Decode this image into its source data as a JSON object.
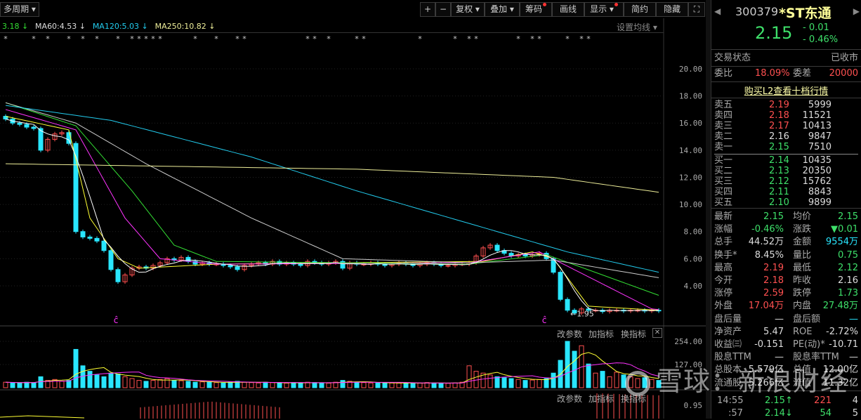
{
  "toolbar": {
    "period": "多周期 ▾",
    "plus": "+",
    "minus": "−",
    "fuquan": "复权",
    "diejia": "叠加",
    "chouma": "筹码",
    "huaxian": "画线",
    "xianshi": "显示",
    "jianyue": "简约",
    "yincang": "隐藏",
    "fullscreen": "⛶",
    "arrow": "▾"
  },
  "legend": {
    "ma30": "3.18 ↓",
    "ma60": "MA60:4.53 ↓",
    "ma120": "MA120:5.03 ↓",
    "ma250": "MA250:10.82 ↓",
    "settings": "设置均线 ▾"
  },
  "axis": {
    "price": [
      "20.00",
      "18.00",
      "16.00",
      "14.00",
      "12.00",
      "10.00",
      "8.00",
      "6.00",
      "4.00"
    ],
    "volume": [
      "254.00",
      "127.00"
    ],
    "third": [
      "0.95"
    ]
  },
  "annotations": {
    "low_label": "←1.95",
    "marker": "ĉ",
    "star": "*"
  },
  "sub_panel": {
    "change_params": "改参数",
    "add_indicator": "加指标",
    "switch_indicator": "换指标",
    "close": "✕"
  },
  "colors": {
    "up": "#ff5050",
    "down": "#29e6ff",
    "ma5": "#ffffff",
    "ma10": "#ffff33",
    "ma20": "#ff33ff",
    "ma30": "#33dd33",
    "ma60": "#cccccc",
    "ma120": "#22ccee",
    "ma250": "#eeee99"
  },
  "chart_data": {
    "type": "candlestick",
    "closes": [
      16.3,
      16.0,
      15.9,
      15.7,
      15.6,
      14.0,
      14.8,
      15.2,
      15.3,
      14.5,
      8.0,
      7.6,
      7.5,
      7.3,
      6.6,
      5.2,
      4.3,
      4.8,
      5.3,
      5.4,
      5.3,
      5.5,
      5.7,
      6.0,
      5.9,
      6.1,
      5.8,
      5.6,
      5.7,
      5.6,
      5.6,
      5.5,
      5.4,
      5.2,
      5.5,
      5.6,
      5.7,
      5.6,
      5.8,
      5.6,
      5.7,
      5.6,
      5.5,
      5.8,
      5.7,
      5.6,
      5.7,
      5.8,
      5.3,
      5.7,
      5.6,
      5.6,
      5.7,
      5.6,
      5.5,
      5.6,
      5.7,
      5.6,
      5.5,
      5.6,
      5.7,
      5.6,
      5.5,
      5.5,
      5.6,
      5.6,
      5.7,
      6.2,
      6.8,
      7.0,
      6.6,
      6.4,
      6.2,
      6.3,
      6.2,
      6.3,
      6.4,
      6.0,
      5.0,
      3.0,
      2.2,
      2.0,
      2.3,
      2.2,
      2.2,
      2.1,
      2.2,
      2.2,
      2.15,
      2.2,
      2.2,
      2.15,
      2.2,
      2.15
    ],
    "volumes": [
      30,
      28,
      25,
      30,
      26,
      60,
      40,
      45,
      35,
      40,
      210,
      120,
      90,
      70,
      60,
      80,
      75,
      60,
      50,
      40,
      35,
      40,
      45,
      50,
      40,
      38,
      35,
      30,
      32,
      30,
      28,
      26,
      30,
      35,
      30,
      28,
      26,
      30,
      28,
      26,
      25,
      28,
      26,
      30,
      28,
      26,
      25,
      30,
      40,
      35,
      30,
      28,
      26,
      25,
      28,
      26,
      25,
      24,
      26,
      25,
      28,
      26,
      25,
      24,
      26,
      30,
      120,
      90,
      80,
      70,
      60,
      55,
      50,
      45,
      40,
      42,
      45,
      50,
      80,
      150,
      254,
      200,
      230,
      130,
      80,
      90,
      60,
      85,
      70,
      60,
      50,
      55,
      45,
      40
    ],
    "ma_knots": {
      "ma10": [
        [
          0,
          16.5
        ],
        [
          9,
          15.5
        ],
        [
          12,
          9
        ],
        [
          16,
          6
        ],
        [
          19,
          5.3
        ],
        [
          30,
          5.6
        ],
        [
          68,
          5.8
        ],
        [
          75,
          6.5
        ],
        [
          78,
          6.0
        ],
        [
          83,
          2.5
        ],
        [
          93,
          2.2
        ]
      ],
      "ma20": [
        [
          0,
          17
        ],
        [
          10,
          15.5
        ],
        [
          17,
          9
        ],
        [
          22,
          6
        ],
        [
          30,
          5.6
        ],
        [
          66,
          5.7
        ],
        [
          76,
          6.5
        ],
        [
          92,
          2.3
        ],
        [
          93,
          2.25
        ]
      ],
      "ma30": [
        [
          0,
          17.5
        ],
        [
          10,
          15.8
        ],
        [
          18,
          11
        ],
        [
          24,
          7
        ],
        [
          30,
          5.8
        ],
        [
          66,
          5.6
        ],
        [
          77,
          6.3
        ],
        [
          93,
          3.3
        ]
      ],
      "ma60": [
        [
          0,
          17.5
        ],
        [
          10,
          16
        ],
        [
          20,
          13
        ],
        [
          35,
          9
        ],
        [
          48,
          6
        ],
        [
          66,
          5.7
        ],
        [
          78,
          5.9
        ],
        [
          93,
          4.6
        ]
      ],
      "ma120": [
        [
          0,
          17.3
        ],
        [
          15,
          16.2
        ],
        [
          35,
          13.5
        ],
        [
          50,
          11
        ],
        [
          70,
          8.0
        ],
        [
          80,
          6.5
        ],
        [
          93,
          5.0
        ]
      ],
      "ma250": [
        [
          0,
          13.0
        ],
        [
          50,
          12.6
        ],
        [
          78,
          12.0
        ],
        [
          93,
          10.9
        ]
      ]
    },
    "star_indices": [
      0,
      4,
      6,
      9,
      11,
      13,
      16,
      18,
      19,
      20,
      21,
      22,
      27,
      30,
      33,
      34,
      43,
      44,
      46,
      50,
      51,
      59,
      64,
      66,
      67,
      73,
      75,
      76,
      80,
      82,
      83
    ],
    "marker_indices": [
      16,
      77
    ],
    "ylim": [
      1.5,
      20.5
    ]
  },
  "quote": {
    "code": "300379",
    "name": "*ST东通",
    "price": "2.15",
    "change": "- 0.01",
    "pct": "- 0.46%",
    "status_label": "交易状态",
    "status": "已收市",
    "weibi_label": "委比",
    "weibi": "18.09%",
    "weicha_label": "委差",
    "weicha": "20000",
    "l2": "购买L2查看十档行情",
    "asks": [
      {
        "l": "卖五",
        "p": "2.19",
        "v": "5999",
        "c": "red"
      },
      {
        "l": "卖四",
        "p": "2.18",
        "v": "11521",
        "c": "red"
      },
      {
        "l": "卖三",
        "p": "2.17",
        "v": "10413",
        "c": "red"
      },
      {
        "l": "卖二",
        "p": "2.16",
        "v": "9847",
        "c": "wht"
      },
      {
        "l": "卖一",
        "p": "2.15",
        "v": "7510",
        "c": "grn"
      }
    ],
    "bids": [
      {
        "l": "买一",
        "p": "2.14",
        "v": "10435",
        "c": "grn"
      },
      {
        "l": "买二",
        "p": "2.13",
        "v": "20350",
        "c": "grn"
      },
      {
        "l": "买三",
        "p": "2.12",
        "v": "15762",
        "c": "grn"
      },
      {
        "l": "买四",
        "p": "2.11",
        "v": "8843",
        "c": "grn"
      },
      {
        "l": "买五",
        "p": "2.10",
        "v": "9899",
        "c": "grn"
      }
    ],
    "stats": [
      {
        "l1": "最新",
        "v1": "2.15",
        "c1": "grn",
        "l2": "均价",
        "v2": "2.15",
        "c2": "grn"
      },
      {
        "l1": "涨幅",
        "v1": "-0.46%",
        "c1": "grn",
        "l2": "涨跌",
        "v2": "▼0.01",
        "c2": "grn"
      },
      {
        "l1": "总手",
        "v1": "44.52万",
        "c1": "wht",
        "l2": "金额",
        "v2": "9554万",
        "c2": "cyan"
      },
      {
        "l1": "换手*",
        "v1": "8.45%",
        "c1": "wht",
        "l2": "量比",
        "v2": "0.75",
        "c2": "grn"
      },
      {
        "l1": "最高",
        "v1": "2.19",
        "c1": "red",
        "l2": "最低",
        "v2": "2.12",
        "c2": "grn"
      },
      {
        "l1": "今开",
        "v1": "2.18",
        "c1": "red",
        "l2": "昨收",
        "v2": "2.16",
        "c2": "wht"
      },
      {
        "l1": "涨停",
        "v1": "2.59",
        "c1": "red",
        "l2": "跌停",
        "v2": "1.73",
        "c2": "grn"
      },
      {
        "l1": "外盘",
        "v1": "17.04万",
        "c1": "red",
        "l2": "内盘",
        "v2": "27.48万",
        "c2": "grn"
      },
      {
        "l1": "盘后量",
        "v1": "—",
        "c1": "wht",
        "l2": "盘后额",
        "v2": "—",
        "c2": "cyan"
      },
      {
        "l1": "净资产",
        "v1": "5.47",
        "c1": "wht",
        "l2": "ROE",
        "v2": "-2.72%",
        "c2": "wht"
      },
      {
        "l1": "收益㈢",
        "v1": "-0.151",
        "c1": "wht",
        "l2": "PE(动)*",
        "v2": "-10.71",
        "c2": "wht"
      },
      {
        "l1": "股息TTM",
        "v1": "—",
        "c1": "wht",
        "l2": "股息率TTM",
        "v2": "—",
        "c2": "wht"
      },
      {
        "l1": "总股本",
        "v1": "5.579亿",
        "c1": "wht",
        "l2": "总值",
        "v2": "12.00亿",
        "c2": "wht"
      },
      {
        "l1": "流通股",
        "v1": "5.266亿",
        "c1": "wht",
        "l2": "流值",
        "v2": "11.32亿",
        "c2": "wht"
      }
    ],
    "ticks": [
      {
        "t": "14:55",
        "p": "2.15↑",
        "v": "221",
        "n": "4",
        "vc": "red"
      },
      {
        "t": ":57",
        "p": "2.14↓",
        "v": "54",
        "n": "5",
        "vc": "grn"
      }
    ]
  },
  "watermark": "雪球：新浪财经"
}
